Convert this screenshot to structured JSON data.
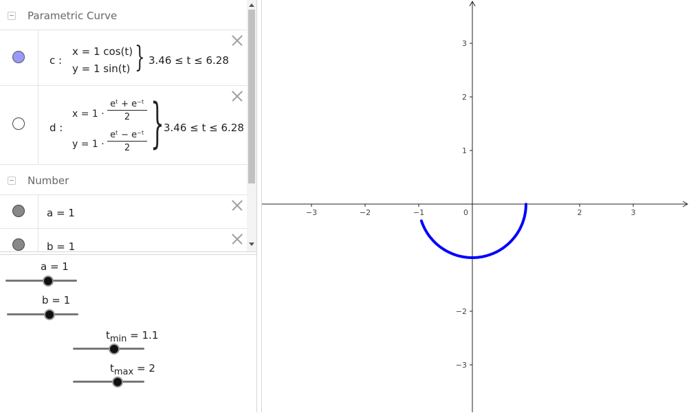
{
  "algebra": {
    "groups": [
      {
        "title": "Parametric Curve"
      },
      {
        "title": "Number"
      }
    ],
    "curve_c": {
      "name": "c :",
      "x_eq": "x = 1  cos(t)",
      "y_eq": "y = 1  sin(t)",
      "range": "3.46 ≤ t ≤ 6.28",
      "marble_color": "#9999ff",
      "visible": true
    },
    "curve_d": {
      "name": "d :",
      "x_lead": "x = 1 ·",
      "x_num": "eᵗ + e⁻ᵗ",
      "x_den": "2",
      "y_lead": "y = 1 ·",
      "y_num": "eᵗ − e⁻ᵗ",
      "y_den": "2",
      "range": "3.46 ≤ t ≤ 6.28",
      "visible": false
    },
    "numbers": [
      {
        "text": "a = 1",
        "marble_color": "#888888"
      },
      {
        "text": "b = 1",
        "marble_color": "#888888"
      }
    ]
  },
  "sliders": [
    {
      "label_main": "a = 1",
      "value": 1,
      "min": -5,
      "max": 5
    },
    {
      "label_main": "b = 1",
      "value": 1,
      "min": -5,
      "max": 5
    },
    {
      "label_prefix": "t",
      "label_sub": "min",
      "label_suffix": " = 1.1"
    },
    {
      "label_prefix": "t",
      "label_sub": "max",
      "label_suffix": " = 2"
    }
  ],
  "graph": {
    "x_ticks": [
      "−3",
      "−2",
      "−1",
      "0",
      "2",
      "3"
    ],
    "y_ticks": [
      "3",
      "2",
      "1",
      "−2",
      "−3"
    ],
    "curve_color": "#0000ff",
    "chart_data": {
      "type": "line",
      "series": [
        {
          "x": [
            -0.95,
            -0.82,
            -0.6,
            -0.31,
            0.0,
            0.31,
            0.6,
            0.82,
            0.95,
            1.0
          ],
          "y": [
            -0.32,
            -0.57,
            -0.8,
            -0.95,
            -1.0,
            -0.95,
            -0.8,
            -0.57,
            -0.31,
            0.0
          ]
        }
      ],
      "xlim": [
        -3.9,
        4.0
      ],
      "ylim": [
        -3.8,
        3.8
      ],
      "grid": false
    }
  }
}
